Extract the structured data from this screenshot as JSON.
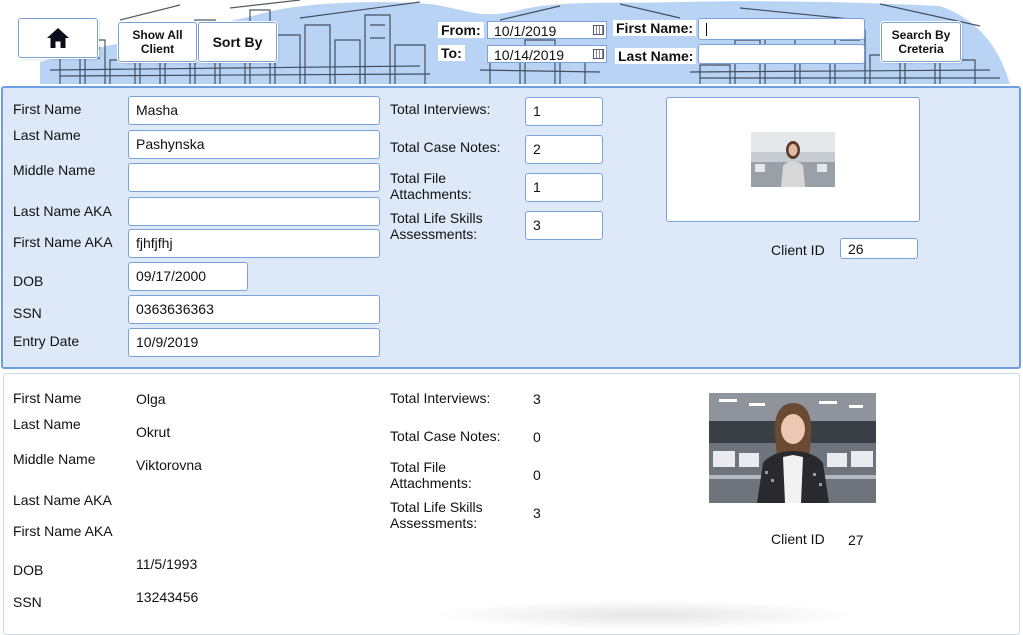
{
  "header": {
    "home_icon": "home-icon",
    "show_all_label": "Show All Client",
    "sort_by_label": "Sort By",
    "from_label": "From:",
    "from_value": "10/1/2019",
    "to_label": "To:",
    "to_value": "10/14/2019",
    "calendar_icon": "calendar-icon",
    "first_name_label": "First Name:",
    "first_name_value": "",
    "last_name_label": "Last Name:",
    "last_name_value": "",
    "search_label": "Search By Creteria"
  },
  "labels": {
    "first_name": "First Name",
    "last_name": "Last Name",
    "middle_name": "Middle Name",
    "last_name_aka": "Last Name AKA",
    "first_name_aka": "First Name AKA",
    "dob": "DOB",
    "ssn": "SSN",
    "entry_date": "Entry Date",
    "total_interviews": "Total Interviews:",
    "total_case_notes": "Total Case Notes:",
    "total_file_attachments": "Total File Attachments:",
    "total_life_skills": "Total Life Skills Assessments:",
    "client_id": "Client ID"
  },
  "clients": [
    {
      "first_name": "Masha",
      "last_name": "Pashynska",
      "middle_name": "",
      "last_name_aka": "",
      "first_name_aka": "fjhfjfhj",
      "dob": "09/17/2000",
      "ssn": "0363636363",
      "entry_date": "10/9/2019",
      "total_interviews": "1",
      "total_case_notes": "2",
      "total_file_attachments": "1",
      "total_life_skills": "3",
      "client_id": "26"
    },
    {
      "first_name": "Olga",
      "last_name": "Okrut",
      "middle_name": "Viktorovna",
      "last_name_aka": "",
      "first_name_aka": "",
      "dob": "11/5/1993",
      "ssn": "13243456",
      "total_interviews": "3",
      "total_case_notes": "0",
      "total_file_attachments": "0",
      "total_life_skills": "3",
      "client_id": "27"
    }
  ],
  "colors": {
    "accent": "#6e9fe3",
    "panel_bg": "#dde9f8",
    "sketch_bg": "#b9d3f5"
  }
}
